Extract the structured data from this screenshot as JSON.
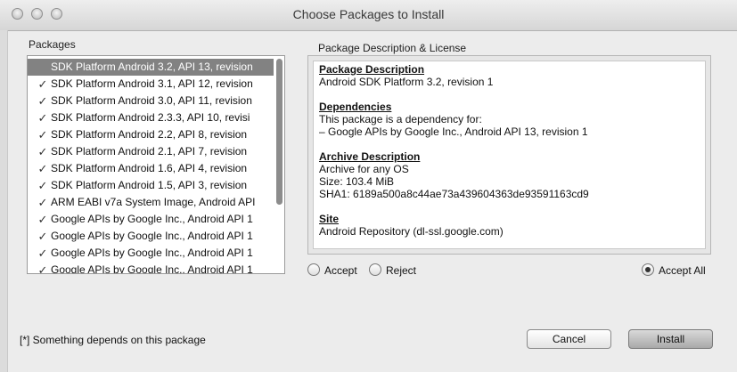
{
  "window": {
    "title": "Choose Packages to Install"
  },
  "packages": {
    "label": "Packages",
    "items": [
      {
        "check": "",
        "label": "SDK Platform Android 3.2, API 13, revision",
        "selected": true
      },
      {
        "check": "✓",
        "label": "SDK Platform Android 3.1, API 12, revision"
      },
      {
        "check": "✓",
        "label": "SDK Platform Android 3.0, API 11, revision"
      },
      {
        "check": "✓",
        "label": "SDK Platform Android 2.3.3, API 10, revisi"
      },
      {
        "check": "✓",
        "label": "SDK Platform Android 2.2, API 8, revision"
      },
      {
        "check": "✓",
        "label": "SDK Platform Android 2.1, API 7, revision"
      },
      {
        "check": "✓",
        "label": "SDK Platform Android 1.6, API 4, revision"
      },
      {
        "check": "✓",
        "label": "SDK Platform Android 1.5, API 3, revision"
      },
      {
        "check": "✓",
        "label": "ARM EABI v7a System Image, Android API"
      },
      {
        "check": "✓",
        "label": "Google APIs by Google Inc., Android API 1"
      },
      {
        "check": "✓",
        "label": "Google APIs by Google Inc., Android API 1"
      },
      {
        "check": "✓",
        "label": "Google APIs by Google Inc., Android API 1"
      },
      {
        "check": "✓",
        "label": "Google APIs by Google Inc., Android API 1"
      }
    ]
  },
  "description": {
    "label": "Package Description & License",
    "package_heading": "Package Description",
    "package_text": "Android SDK Platform 3.2, revision 1",
    "dependencies_heading": "Dependencies",
    "dependencies_text": "This package is a dependency for:",
    "dependencies_item": "– Google APIs by Google Inc., Android API 13, revision 1",
    "archive_heading": "Archive Description",
    "archive_os": "Archive for any OS",
    "archive_size": "Size: 103.4 MiB",
    "archive_sha": "SHA1: 6189a500a8c44ae73a439604363de93591163cd9",
    "site_heading": "Site",
    "site_text": "Android Repository (dl-ssl.google.com)"
  },
  "options": {
    "accept": "Accept",
    "reject": "Reject",
    "accept_all": "Accept All"
  },
  "footer": {
    "note": "[*] Something depends on this package",
    "cancel": "Cancel",
    "install": "Install"
  }
}
